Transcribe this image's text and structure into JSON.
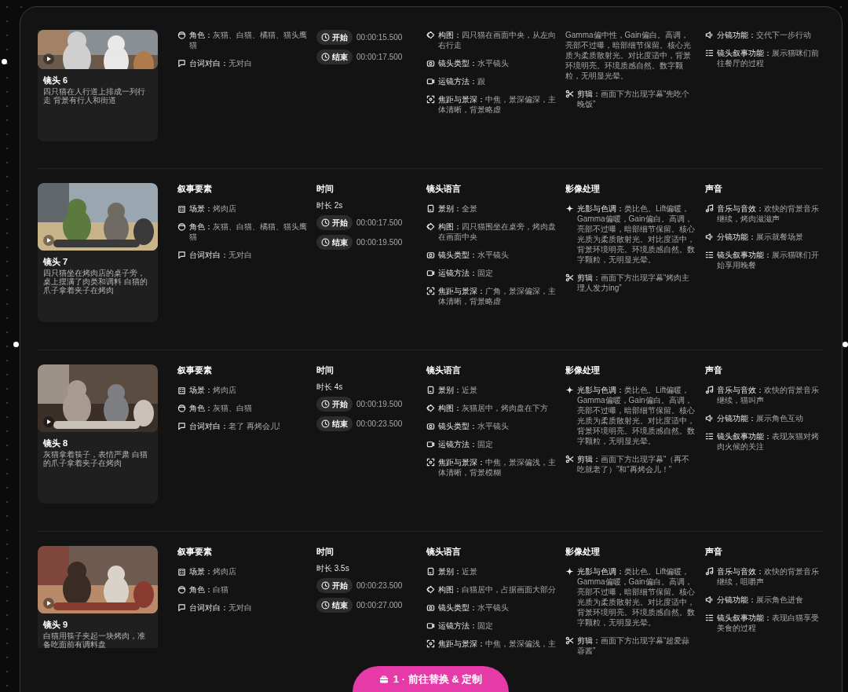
{
  "shots": [
    {
      "title": "镜头 6",
      "description": "四只猫在人行道上排成一列行走 背景有行人和街道",
      "narrative": {
        "items": [
          {
            "kind": "role",
            "label": "角色：",
            "value": "灰猫、白猫、橘猫、猫头鹰猫"
          },
          {
            "kind": "dialogue",
            "label": "台词对白：",
            "value": "无对白"
          }
        ]
      },
      "time": {
        "chips": [
          {
            "label": "开始",
            "value": "00:00:15.500"
          },
          {
            "label": "结束",
            "value": "00:00:17.500"
          }
        ]
      },
      "shot": {
        "items": [
          {
            "kind": "composition",
            "label": "构图：",
            "value": "四只猫在画面中央，从左向右行走"
          },
          {
            "kind": "type",
            "label": "镜头类型：",
            "value": "水平镜头"
          },
          {
            "kind": "movement",
            "label": "运镜方法：",
            "value": "跟"
          },
          {
            "kind": "focus",
            "label": "焦距与景深：",
            "value": "中焦，景深偏深，主体清晰，背景略虚"
          }
        ]
      },
      "image": {
        "items": [
          {
            "kind": "continuation",
            "value": "Gamma偏中性，Gain偏白。高调，亮部不过曝，暗部细节保留。核心光质为柔质散射光。对比度适中，背景环境明亮。环境质感自然。数字颗粒，无明显光晕。"
          },
          {
            "kind": "edit",
            "label": "剪辑：",
            "value": "画面下方出现字幕“先吃个晚饭”"
          }
        ]
      },
      "sound": {
        "items": [
          {
            "kind": "function",
            "label": "分镜功能：",
            "value": "交代下一步行动"
          },
          {
            "kind": "story",
            "label": "镜头叙事功能：",
            "value": "展示猫咪们前往餐厅的过程"
          }
        ]
      }
    },
    {
      "title": "镜头 7",
      "description": "四只猫坐在烤肉店的桌子旁，桌上摆满了肉类和调料 白猫的爪子拿着夹子在烤肉",
      "narrative": {
        "heading": "叙事要素",
        "items": [
          {
            "kind": "scene",
            "label": "场景：",
            "value": "烤肉店"
          },
          {
            "kind": "role",
            "label": "角色：",
            "value": "灰猫、白猫、橘猫、猫头鹰猫"
          },
          {
            "kind": "dialogue",
            "label": "台词对白：",
            "value": "无对白"
          }
        ]
      },
      "time": {
        "heading": "时间",
        "duration": "时长 2s",
        "chips": [
          {
            "label": "开始",
            "value": "00:00:17.500"
          },
          {
            "label": "结束",
            "value": "00:00:19.500"
          }
        ]
      },
      "shot": {
        "heading": "镜头语言",
        "items": [
          {
            "kind": "size",
            "label": "景别：",
            "value": "全景"
          },
          {
            "kind": "composition",
            "label": "构图：",
            "value": "四只猫围坐在桌旁，烤肉盘在画面中央"
          },
          {
            "kind": "type",
            "label": "镜头类型：",
            "value": "水平镜头"
          },
          {
            "kind": "movement",
            "label": "运镜方法：",
            "value": "固定"
          },
          {
            "kind": "focus",
            "label": "焦距与景深：",
            "value": "广角，景深偏深，主体清晰，背景略虚"
          }
        ]
      },
      "image": {
        "heading": "影像处理",
        "items": [
          {
            "kind": "lighting",
            "label": "光影与色调：",
            "value": "类比色。Lift偏暖，Gamma偏暖，Gain偏白。高调，亮部不过曝，暗部细节保留。核心光质为柔质散射光。对比度适中，背景环境明亮。环境质感自然。数字颗粒，无明显光晕。"
          },
          {
            "kind": "edit",
            "label": "剪辑：",
            "value": "画面下方出现字幕“烤肉主理人发力ing”"
          }
        ]
      },
      "sound": {
        "heading": "声音",
        "items": [
          {
            "kind": "music",
            "label": "音乐与音效：",
            "value": "欢快的背景音乐继续，烤肉滋滋声"
          },
          {
            "kind": "function",
            "label": "分镜功能：",
            "value": "展示就餐场景"
          },
          {
            "kind": "story",
            "label": "镜头叙事功能：",
            "value": "展示猫咪们开始享用晚餐"
          }
        ]
      }
    },
    {
      "title": "镜头 8",
      "description": "灰猫拿着筷子，表情严肃 白猫的爪子拿着夹子在烤肉",
      "narrative": {
        "heading": "叙事要素",
        "items": [
          {
            "kind": "scene",
            "label": "场景：",
            "value": "烤肉店"
          },
          {
            "kind": "role",
            "label": "角色：",
            "value": "灰猫、白猫"
          },
          {
            "kind": "dialogue",
            "label": "台词对白：",
            "value": "老了 再烤会儿!"
          }
        ]
      },
      "time": {
        "heading": "时间",
        "duration": "时长 4s",
        "chips": [
          {
            "label": "开始",
            "value": "00:00:19.500"
          },
          {
            "label": "结束",
            "value": "00:00:23.500"
          }
        ]
      },
      "shot": {
        "heading": "镜头语言",
        "items": [
          {
            "kind": "size",
            "label": "景别：",
            "value": "近景"
          },
          {
            "kind": "composition",
            "label": "构图：",
            "value": "灰猫居中，烤肉盘在下方"
          },
          {
            "kind": "type",
            "label": "镜头类型：",
            "value": "水平镜头"
          },
          {
            "kind": "movement",
            "label": "运镜方法：",
            "value": "固定"
          },
          {
            "kind": "focus",
            "label": "焦距与景深：",
            "value": "中焦，景深偏浅，主体清晰，背景模糊"
          }
        ]
      },
      "image": {
        "heading": "影像处理",
        "items": [
          {
            "kind": "lighting",
            "label": "光影与色调：",
            "value": "类比色。Lift偏暖，Gamma偏暖，Gain偏白。高调，亮部不过曝，暗部细节保留。核心光质为柔质散射光。对比度适中，背景环境明亮。环境质感自然。数字颗粒，无明显光晕。"
          },
          {
            "kind": "edit",
            "label": "剪辑：",
            "value": "画面下方出现字幕“（再不吃就老了）”和“再烤会儿！”"
          }
        ]
      },
      "sound": {
        "heading": "声音",
        "items": [
          {
            "kind": "music",
            "label": "音乐与音效：",
            "value": "欢快的背景音乐继续，猫叫声"
          },
          {
            "kind": "function",
            "label": "分镜功能：",
            "value": "展示角色互动"
          },
          {
            "kind": "story",
            "label": "镜头叙事功能：",
            "value": "表现灰猫对烤肉火候的关注"
          }
        ]
      }
    },
    {
      "title": "镜头 9",
      "description": "白猫用筷子夹起一块烤肉，准备吃面前有调料盘",
      "narrative": {
        "heading": "叙事要素",
        "items": [
          {
            "kind": "scene",
            "label": "场景：",
            "value": "烤肉店"
          },
          {
            "kind": "role",
            "label": "角色：",
            "value": "白猫"
          },
          {
            "kind": "dialogue",
            "label": "台词对白：",
            "value": "无对白"
          }
        ]
      },
      "time": {
        "heading": "时间",
        "duration": "时长 3.5s",
        "chips": [
          {
            "label": "开始",
            "value": "00:00:23.500"
          },
          {
            "label": "结束",
            "value": "00:00:27.000"
          }
        ]
      },
      "shot": {
        "heading": "镜头语言",
        "items": [
          {
            "kind": "size",
            "label": "景别：",
            "value": "近景"
          },
          {
            "kind": "composition",
            "label": "构图：",
            "value": "白猫居中，占据画面大部分"
          },
          {
            "kind": "type",
            "label": "镜头类型：",
            "value": "水平镜头"
          },
          {
            "kind": "movement",
            "label": "运镜方法：",
            "value": "固定"
          },
          {
            "kind": "focus",
            "label": "焦距与景深：",
            "value": "中焦，景深偏浅，主"
          }
        ]
      },
      "image": {
        "heading": "影像处理",
        "items": [
          {
            "kind": "lighting",
            "label": "光影与色调：",
            "value": "类比色。Lift偏暖，Gamma偏暖，Gain偏白。高调，亮部不过曝，暗部细节保留。核心光质为柔质散射光。对比度适中，背景环境明亮。环境质感自然。数字颗粒，无明显光晕。"
          },
          {
            "kind": "edit",
            "label": "剪辑：",
            "value": "画面下方出现字幕“超爱蒜蓉酱”"
          }
        ]
      },
      "sound": {
        "heading": "声音",
        "items": [
          {
            "kind": "music",
            "label": "音乐与音效：",
            "value": "欢快的背景音乐继续，咀嚼声"
          },
          {
            "kind": "function",
            "label": "分镜功能：",
            "value": "展示角色进食"
          },
          {
            "kind": "story",
            "label": "镜头叙事功能：",
            "value": "表现白猫享受美食的过程"
          }
        ]
      }
    }
  ],
  "button": {
    "label": "1 · 前往替换 & 定制"
  }
}
